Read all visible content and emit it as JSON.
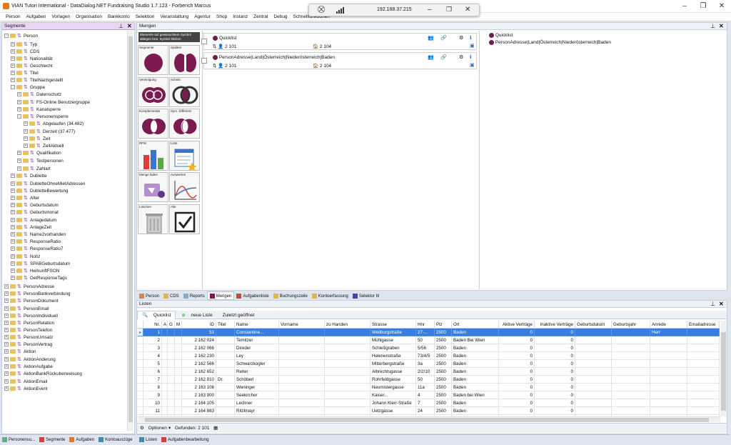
{
  "window": {
    "title": "VIAN Tutori International - DataDialog.NET Fundraising Studio 1.7.123 - Forberich Marcus"
  },
  "menu": [
    "Person",
    "Aufgaben",
    "Vorlagen",
    "Organisation",
    "Bankkonto",
    "Selektion",
    "Veranstaltung",
    "Agentur",
    "Shop",
    "Instanz",
    "Zentral",
    "Debug",
    "Schnellfunktionen"
  ],
  "rdp": {
    "ip": "192.168.37.215"
  },
  "segmente": {
    "title": "Segmente",
    "tree": [
      {
        "label": "Person",
        "indent": 0,
        "exp": "-"
      },
      {
        "label": "Typ",
        "indent": 1,
        "exp": "+"
      },
      {
        "label": "CDS",
        "indent": 1,
        "exp": "+"
      },
      {
        "label": "Nationalität",
        "indent": 1,
        "exp": "+"
      },
      {
        "label": "Geschlecht",
        "indent": 1,
        "exp": "+"
      },
      {
        "label": "Titel",
        "indent": 1,
        "exp": "+"
      },
      {
        "label": "TitelNachgestellt",
        "indent": 1,
        "exp": "+"
      },
      {
        "label": "Gruppe",
        "indent": 1,
        "exp": "-"
      },
      {
        "label": "Datenschutz",
        "indent": 2,
        "exp": "+"
      },
      {
        "label": "FS-Online Benutzergruppe",
        "indent": 2,
        "exp": "+"
      },
      {
        "label": "Kanalsperre",
        "indent": 2,
        "exp": "+"
      },
      {
        "label": "Personensperre",
        "indent": 2,
        "exp": "-"
      },
      {
        "label": "Abgelaufen (34.482)",
        "indent": 3,
        "exp": "+"
      },
      {
        "label": "Derzeit (37.477)",
        "indent": 3,
        "exp": "+"
      },
      {
        "label": "Zeit",
        "indent": 3,
        "exp": "+"
      },
      {
        "label": "ZeitAktuell",
        "indent": 3,
        "exp": "+"
      },
      {
        "label": "Qualifikation",
        "indent": 2,
        "exp": "+"
      },
      {
        "label": "Testpersonen",
        "indent": 2,
        "exp": "+"
      },
      {
        "label": "Zahlart",
        "indent": 2,
        "exp": "+"
      },
      {
        "label": "Dublette",
        "indent": 1,
        "exp": "+"
      },
      {
        "label": "DubletteOhneMietAdressen",
        "indent": 1,
        "exp": "+"
      },
      {
        "label": "DubletteBewertung",
        "indent": 1,
        "exp": "+"
      },
      {
        "label": "Alter",
        "indent": 1,
        "exp": "+"
      },
      {
        "label": "Geburtsdatum",
        "indent": 1,
        "exp": "+"
      },
      {
        "label": "Geburtsmonat",
        "indent": 1,
        "exp": "+"
      },
      {
        "label": "Anlagedatum",
        "indent": 1,
        "exp": "+"
      },
      {
        "label": "AnlageZeit",
        "indent": 1,
        "exp": "+"
      },
      {
        "label": "Name2vorhanden",
        "indent": 1,
        "exp": "+"
      },
      {
        "label": "ResponseRatio",
        "indent": 1,
        "exp": "+"
      },
      {
        "label": "ResponseRatio7",
        "indent": 1,
        "exp": "+"
      },
      {
        "label": "Notiz",
        "indent": 1,
        "exp": "+"
      },
      {
        "label": "SPABGeburtsdatum",
        "indent": 1,
        "exp": "+"
      },
      {
        "label": "HerkunftFSON",
        "indent": 1,
        "exp": "+"
      },
      {
        "label": "GetResponseTags",
        "indent": 1,
        "exp": "+"
      },
      {
        "label": "PersonAdresse",
        "indent": 0,
        "exp": "+"
      },
      {
        "label": "PersonBankverbindung",
        "indent": 0,
        "exp": "+"
      },
      {
        "label": "PersonDokument",
        "indent": 0,
        "exp": "+"
      },
      {
        "label": "PersonEmail",
        "indent": 0,
        "exp": "+"
      },
      {
        "label": "PersonIndividuell",
        "indent": 0,
        "exp": "+"
      },
      {
        "label": "PersonRelation",
        "indent": 0,
        "exp": "+"
      },
      {
        "label": "PersonTelefon",
        "indent": 0,
        "exp": "+"
      },
      {
        "label": "PersonUmsatz",
        "indent": 0,
        "exp": "+"
      },
      {
        "label": "PersonVertrag",
        "indent": 0,
        "exp": "+"
      },
      {
        "label": "Aktion",
        "indent": 0,
        "exp": "+"
      },
      {
        "label": "AktionAnderung",
        "indent": 0,
        "exp": "+"
      },
      {
        "label": "AktionAufgabe",
        "indent": 0,
        "exp": "+"
      },
      {
        "label": "AktionBankRückuberweisung",
        "indent": 0,
        "exp": "+"
      },
      {
        "label": "AktionEmail",
        "indent": 0,
        "exp": "+"
      },
      {
        "label": "AktionEvent",
        "indent": 0,
        "exp": "+"
      }
    ]
  },
  "left_tabs": [
    "Personensu...",
    "Segmente",
    "Aufgaben",
    "Kontoauszüge"
  ],
  "mengen": {
    "title": "Mengen",
    "hint": "Elemente auf gewünschtem Symbol ablegen bzw. Symbol klicken",
    "tools": [
      {
        "label": "Segmente",
        "icon": "segment-circle"
      },
      {
        "label": "Spalten",
        "icon": "split"
      },
      {
        "label": "Vereinigung",
        "icon": "union"
      },
      {
        "label": "Schnitt",
        "icon": "intersection"
      },
      {
        "label": "Komplementär",
        "icon": "complement"
      },
      {
        "label": "Sym. Differenz",
        "icon": "symdiff"
      },
      {
        "label": "RFM",
        "icon": "barchart"
      },
      {
        "label": "Liste",
        "icon": "list"
      },
      {
        "label": "Menge laden",
        "icon": "load"
      },
      {
        "label": "Auswerten",
        "icon": "evaluate"
      },
      {
        "label": "Löschen",
        "icon": "trash"
      },
      {
        "label": "Alle",
        "icon": "checkbox"
      }
    ],
    "sets": [
      {
        "name": "Quicklist",
        "count1": "2 101",
        "count2": "2 104"
      },
      {
        "name": "PersonAdresse|Land|Österreich|Niederösterreich|Baden",
        "count1": "2 101",
        "count2": "2 104"
      }
    ],
    "right_items": [
      "Quicklist",
      "PersonAdresse|Land|Österreich|Niederösterreich|Baden"
    ]
  },
  "bottom_tabs": [
    "Person",
    "CDS",
    "Reports",
    "Mengen",
    "Aufgabenliste",
    "Buchungszeile",
    "Kontoerfassung",
    "Selektor III"
  ],
  "listen": {
    "title": "Listen",
    "tabs": [
      "Quicklist",
      "neue Liste",
      "Zuletzt geöffnet"
    ],
    "columns": [
      "Nr.",
      "A",
      "G",
      "M",
      "ID",
      "Titel",
      "Name",
      "Vorname",
      "zu Handen",
      "Strasse",
      "Hnr",
      "Plz",
      "Ort",
      "Aktive Verträge",
      "Inaktive Verträge",
      "Geburtsdatum",
      "Geburtsjahr",
      "Anrede",
      "Emailadresse"
    ],
    "rows": [
      [
        "1",
        "",
        "",
        "",
        "53",
        "",
        "Constantine...",
        "",
        "",
        "Weilburgstraße",
        "27-...",
        "2500",
        "Baden",
        "0",
        "0",
        "",
        "",
        "Herr",
        ""
      ],
      [
        "2",
        "",
        "",
        "",
        "2 162 024",
        "",
        "Temitzer",
        "",
        "",
        "Mühlgasse",
        "50",
        "2500",
        "Baden Bei Wien",
        "0",
        "0",
        "",
        "",
        "",
        ""
      ],
      [
        "3",
        "",
        "",
        "",
        "2 162 066",
        "",
        "Direder",
        "",
        "",
        "Schießgraben",
        "5/56",
        "2500",
        "Baden",
        "0",
        "0",
        "",
        "",
        "",
        ""
      ],
      [
        "4",
        "",
        "",
        "",
        "2 162 230",
        "",
        "Ley",
        "",
        "",
        "Helenenstraße",
        "73/4/5",
        "2500",
        "Baden",
        "0",
        "0",
        "",
        "",
        "",
        ""
      ],
      [
        "5",
        "",
        "",
        "",
        "2 162 566",
        "",
        "Schwarzkogler",
        "",
        "",
        "Mitterbergstraße",
        "3a",
        "2500",
        "Baden",
        "0",
        "0",
        "",
        "",
        "",
        ""
      ],
      [
        "6",
        "",
        "",
        "",
        "2 162 652",
        "",
        "Reiter",
        "",
        "",
        "Albrechtsgasse",
        "2/2/10",
        "2500",
        "Baden",
        "0",
        "0",
        "",
        "",
        "",
        ""
      ],
      [
        "7",
        "",
        "",
        "",
        "2 162 910",
        "Dr.",
        "Schöberl",
        "",
        "",
        "Rohrfeldgasse",
        "50",
        "2500",
        "Baden",
        "0",
        "0",
        "",
        "",
        "",
        ""
      ],
      [
        "8",
        "",
        "",
        "",
        "2 163 108",
        "",
        "Weninger",
        "",
        "",
        "Neumistergasse",
        "11a",
        "2500",
        "Baden",
        "0",
        "0",
        "",
        "",
        "",
        ""
      ],
      [
        "9",
        "",
        "",
        "",
        "2 163 900",
        "",
        "Seekircher",
        "",
        "",
        "Kaiser...",
        "4",
        "2500",
        "Baden bei Wien",
        "0",
        "0",
        "",
        "",
        "",
        ""
      ],
      [
        "10",
        "",
        "",
        "",
        "2 164 105",
        "",
        "Lechner",
        "",
        "",
        "Johann Klerr-Straße",
        "7",
        "2500",
        "Baden",
        "0",
        "0",
        "",
        "",
        "",
        ""
      ],
      [
        "11",
        "",
        "",
        "",
        "2 164 883",
        "",
        "Ritzlmayr",
        "",
        "",
        "Uetzgasse",
        "24",
        "2500",
        "Baden",
        "0",
        "0",
        "",
        "",
        "",
        ""
      ],
      [
        "12",
        "",
        "",
        "",
        "2 165 067",
        "",
        "Schwarz",
        "",
        "",
        "Andreas Hofer-...",
        "14",
        "2500",
        "Baden",
        "",
        "",
        "",
        "",
        "",
        ""
      ]
    ],
    "status_options": "Optionen",
    "status_found": "Gefunden: 2 101"
  },
  "footer_tabs": [
    "Listen",
    "Aufgabenbearbeitung"
  ],
  "colors": {
    "accent": "#3b7ddd",
    "set_dot": "#6b1f4e",
    "panel_header": "#e9d6f4"
  }
}
